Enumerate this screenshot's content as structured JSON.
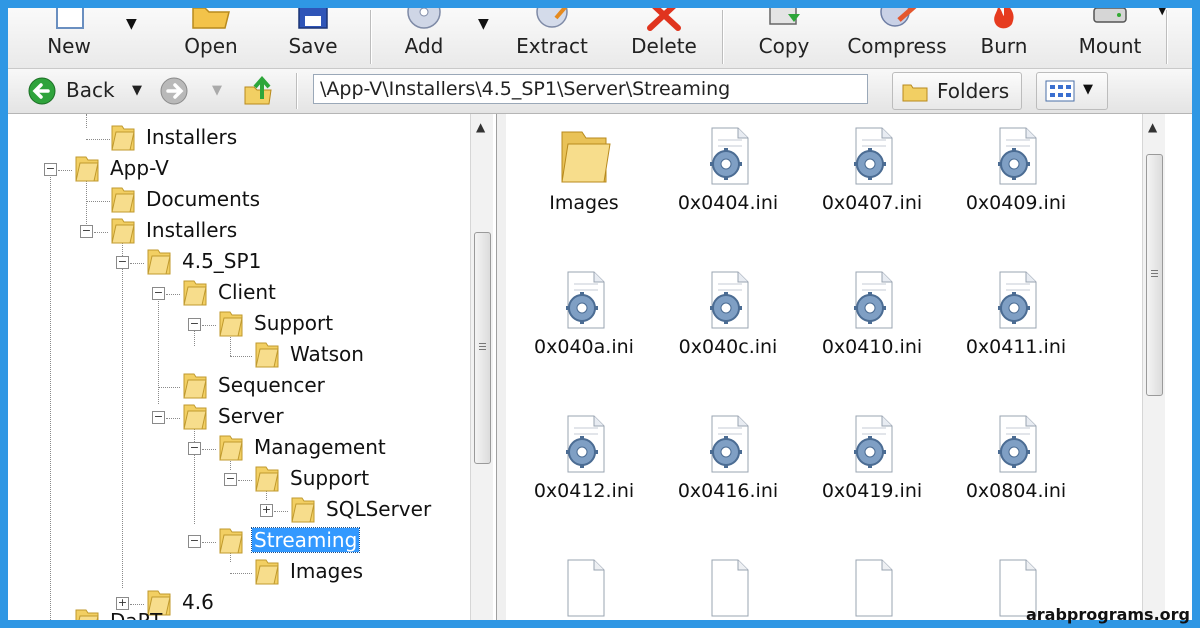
{
  "toolbar": {
    "buttons": [
      {
        "label": "New",
        "icon": "new-file-icon"
      },
      {
        "label": "Open",
        "icon": "open-folder-icon"
      },
      {
        "label": "Save",
        "icon": "floppy-disk-icon"
      },
      {
        "label": "Add",
        "icon": "add-disc-icon"
      },
      {
        "label": "Extract",
        "icon": "extract-icon"
      },
      {
        "label": "Delete",
        "icon": "delete-x-icon"
      },
      {
        "label": "Copy",
        "icon": "copy-icon"
      },
      {
        "label": "Compress",
        "icon": "compress-icon"
      },
      {
        "label": "Burn",
        "icon": "burn-flame-icon"
      },
      {
        "label": "Mount",
        "icon": "mount-drive-icon"
      }
    ]
  },
  "nav": {
    "back_label": "Back",
    "address": "\\App-V\\Installers\\4.5_SP1\\Server\\Streaming",
    "folders_label": "Folders"
  },
  "tree": {
    "items": [
      {
        "label": "Installers",
        "expander": "",
        "selected": false
      },
      {
        "label": "App-V",
        "expander": "−",
        "selected": false
      },
      {
        "label": "Documents",
        "expander": "",
        "selected": false
      },
      {
        "label": "Installers",
        "expander": "−",
        "selected": false
      },
      {
        "label": "4.5_SP1",
        "expander": "−",
        "selected": false
      },
      {
        "label": "Client",
        "expander": "−",
        "selected": false
      },
      {
        "label": "Support",
        "expander": "−",
        "selected": false
      },
      {
        "label": "Watson",
        "expander": "",
        "selected": false
      },
      {
        "label": "Sequencer",
        "expander": "",
        "selected": false
      },
      {
        "label": "Server",
        "expander": "−",
        "selected": false
      },
      {
        "label": "Management",
        "expander": "−",
        "selected": false
      },
      {
        "label": "Support",
        "expander": "−",
        "selected": false
      },
      {
        "label": "SQLServer",
        "expander": "+",
        "selected": false
      },
      {
        "label": "Streaming",
        "expander": "−",
        "selected": true
      },
      {
        "label": "Images",
        "expander": "",
        "selected": false
      },
      {
        "label": "4.6",
        "expander": "+",
        "selected": false
      },
      {
        "label": "DaRT",
        "expander": "",
        "selected": false
      }
    ]
  },
  "files": {
    "items": [
      {
        "label": "Images",
        "icon": "folder-icon"
      },
      {
        "label": "0x0404.ini",
        "icon": "ini-settings-file-icon"
      },
      {
        "label": "0x0407.ini",
        "icon": "ini-settings-file-icon"
      },
      {
        "label": "0x0409.ini",
        "icon": "ini-settings-file-icon"
      },
      {
        "label": "0x040a.ini",
        "icon": "ini-settings-file-icon"
      },
      {
        "label": "0x040c.ini",
        "icon": "ini-settings-file-icon"
      },
      {
        "label": "0x0410.ini",
        "icon": "ini-settings-file-icon"
      },
      {
        "label": "0x0411.ini",
        "icon": "ini-settings-file-icon"
      },
      {
        "label": "0x0412.ini",
        "icon": "ini-settings-file-icon"
      },
      {
        "label": "0x0416.ini",
        "icon": "ini-settings-file-icon"
      },
      {
        "label": "0x0419.ini",
        "icon": "ini-settings-file-icon"
      },
      {
        "label": "0x0804.ini",
        "icon": "ini-settings-file-icon"
      },
      {
        "label": "",
        "icon": "blank-file-icon"
      },
      {
        "label": "",
        "icon": "blank-file-icon"
      },
      {
        "label": "",
        "icon": "blank-file-icon"
      },
      {
        "label": "",
        "icon": "blank-file-icon"
      }
    ]
  },
  "watermark": "arabprograms.org",
  "colors": {
    "frame_border": "#2f97e4",
    "selection": "#3399ff",
    "folder": "#f2cf63"
  }
}
